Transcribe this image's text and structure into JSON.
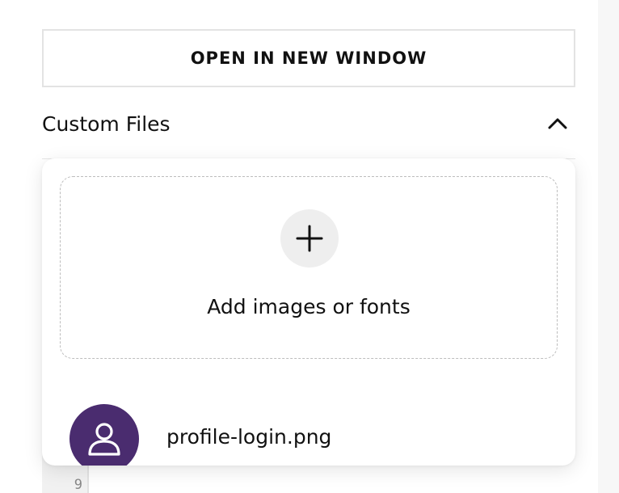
{
  "open_window_button": {
    "label": "OPEN IN NEW WINDOW"
  },
  "custom_files": {
    "title": "Custom Files",
    "expanded": true,
    "chevron_icon": "chevron-up-icon",
    "dropzone": {
      "icon": "plus-icon",
      "label": "Add images or fonts"
    },
    "files": [
      {
        "name": "profile-login.png",
        "icon": "user-icon",
        "icon_bg": "#4a2c6f"
      }
    ]
  },
  "editor": {
    "gutter_line": "9"
  }
}
